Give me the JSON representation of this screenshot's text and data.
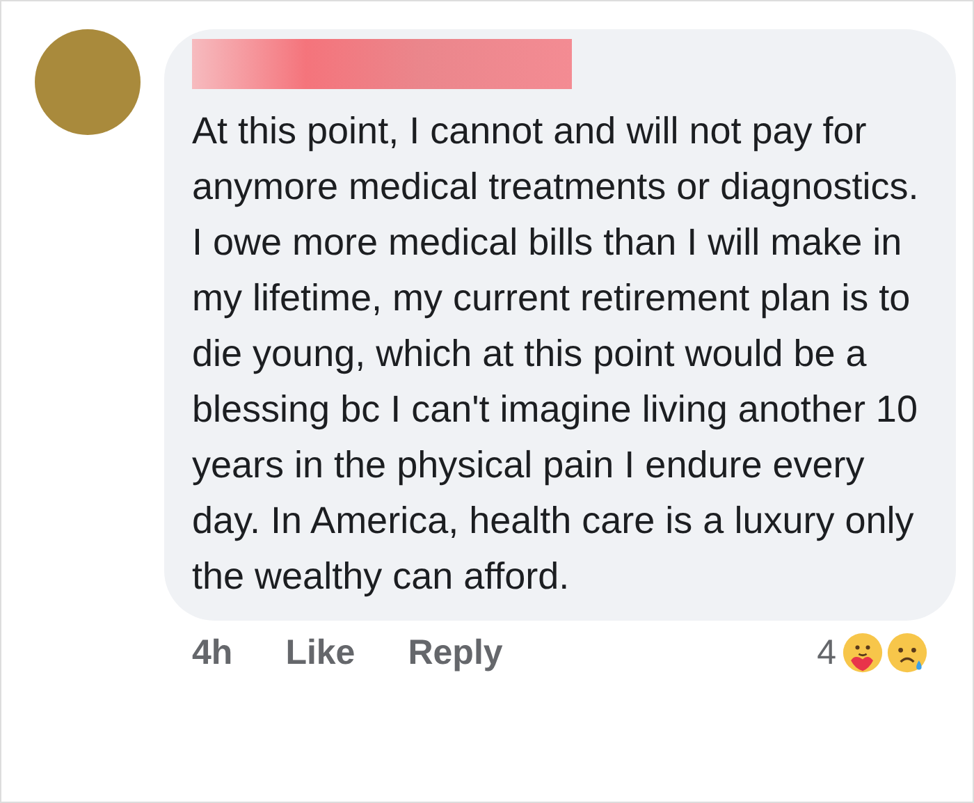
{
  "comment": {
    "text": "At this point, I cannot and will not pay for anymore medical treatments or diagnostics. I owe more medical bills than I will make in my lifetime, my current retirement plan is to die young, which at this point would be a blessing bc I can't imagine living another 10 years in the physical pain I endure every day. In America, health care is a luxury only the wealthy can afford.",
    "time": "4h",
    "actions": [
      "Like",
      "Reply"
    ],
    "reaction_count": "4",
    "reactions": [
      {
        "kind": "care"
      },
      {
        "kind": "sad"
      }
    ]
  }
}
